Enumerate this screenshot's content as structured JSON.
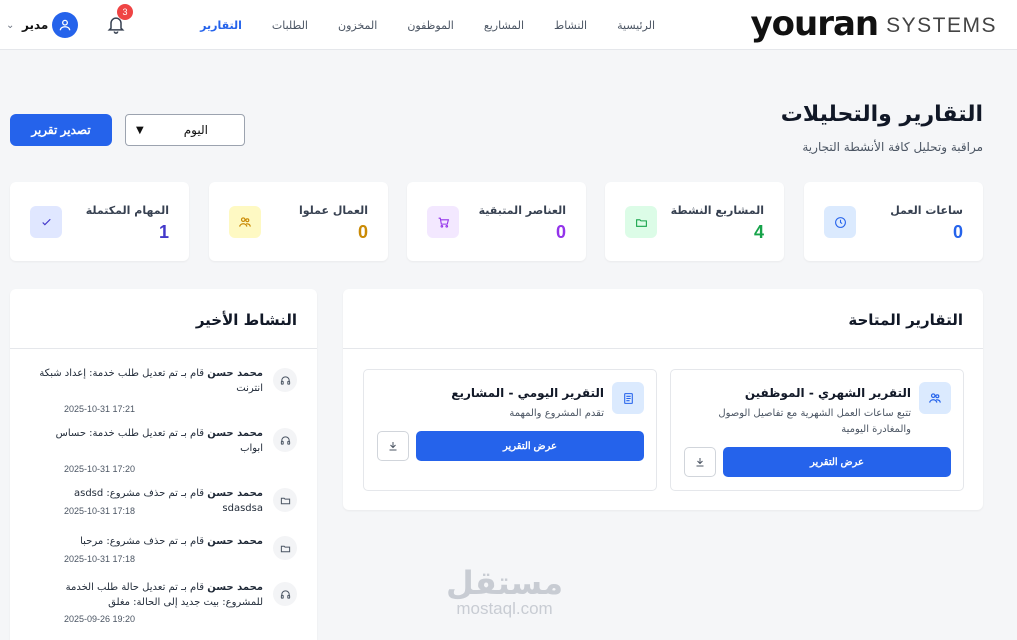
{
  "brand": {
    "logo_main": "youran",
    "logo_sub": "SYSTEMS"
  },
  "nav": [
    {
      "label": "الرئيسية",
      "active": false
    },
    {
      "label": "النشاط",
      "active": false
    },
    {
      "label": "المشاريع",
      "active": false
    },
    {
      "label": "الموظفون",
      "active": false
    },
    {
      "label": "المخزون",
      "active": false
    },
    {
      "label": "الطلبات",
      "active": false
    },
    {
      "label": "التقارير",
      "active": true
    }
  ],
  "user": {
    "name": "مدير",
    "notifications": "3"
  },
  "page": {
    "title": "التقارير والتحليلات",
    "subtitle": "مراقبة وتحليل كافة الأنشطة التجارية",
    "export_label": "تصدير تقرير",
    "period_value": "اليوم"
  },
  "stats": [
    {
      "label": "ساعات العمل",
      "value": "0",
      "color": "#2563eb",
      "icon": "clock-icon",
      "icon_bg": "#dbeafe"
    },
    {
      "label": "المشاريع النشطة",
      "value": "4",
      "color": "#16a34a",
      "icon": "folder-icon",
      "icon_bg": "#dcfce7"
    },
    {
      "label": "العناصر المتبقية",
      "value": "0",
      "color": "#9333ea",
      "icon": "cart-icon",
      "icon_bg": "#f3e8ff"
    },
    {
      "label": "العمال عملوا",
      "value": "0",
      "color": "#ca8a04",
      "icon": "users-icon",
      "icon_bg": "#fef9c3"
    },
    {
      "label": "المهام المكتملة",
      "value": "1",
      "color": "#4338ca",
      "icon": "check-icon",
      "icon_bg": "#e0e7ff"
    }
  ],
  "reports_panel": {
    "title": "التقارير المتاحة",
    "reports": [
      {
        "title": "التقرير الشهري - الموظفين",
        "desc": "تتبع ساعات العمل الشهرية مع تفاصيل الوصول والمغادرة اليومية",
        "button": "عرض التقرير",
        "icon": "users-icon"
      },
      {
        "title": "التقرير اليومي - المشاريع",
        "desc": "تقدم المشروع والمهمة",
        "button": "عرض التقرير",
        "icon": "document-icon"
      }
    ]
  },
  "activity_panel": {
    "title": "النشاط الأخير",
    "items": [
      {
        "user": "محمد حسن",
        "text": "قام بـ تم تعديل طلب خدمة: إعداد شبكة انترنت",
        "time": "2025-10-31 17:21",
        "icon": "headset-icon"
      },
      {
        "user": "محمد حسن",
        "text": "قام بـ تم تعديل طلب خدمة: حساس ابواب",
        "time": "2025-10-31 17:20",
        "icon": "headset-icon"
      },
      {
        "user": "محمد حسن",
        "text": "قام بـ تم حذف مشروع: asdsd sdasdsa",
        "time": "2025-10-31 17:18",
        "icon": "folder-icon"
      },
      {
        "user": "محمد حسن",
        "text": "قام بـ تم حذف مشروع: مرحبا",
        "time": "2025-10-31 17:18",
        "icon": "folder-icon"
      },
      {
        "user": "محمد حسن",
        "text": "قام بـ تم تعديل حالة طلب الخدمة للمشروع: بيت جديد إلى الحالة: مغلق",
        "time": "2025-09-26 19:20",
        "icon": "headset-icon"
      }
    ]
  },
  "watermark": {
    "ar": "مستقل",
    "en": "mostaql.com"
  }
}
